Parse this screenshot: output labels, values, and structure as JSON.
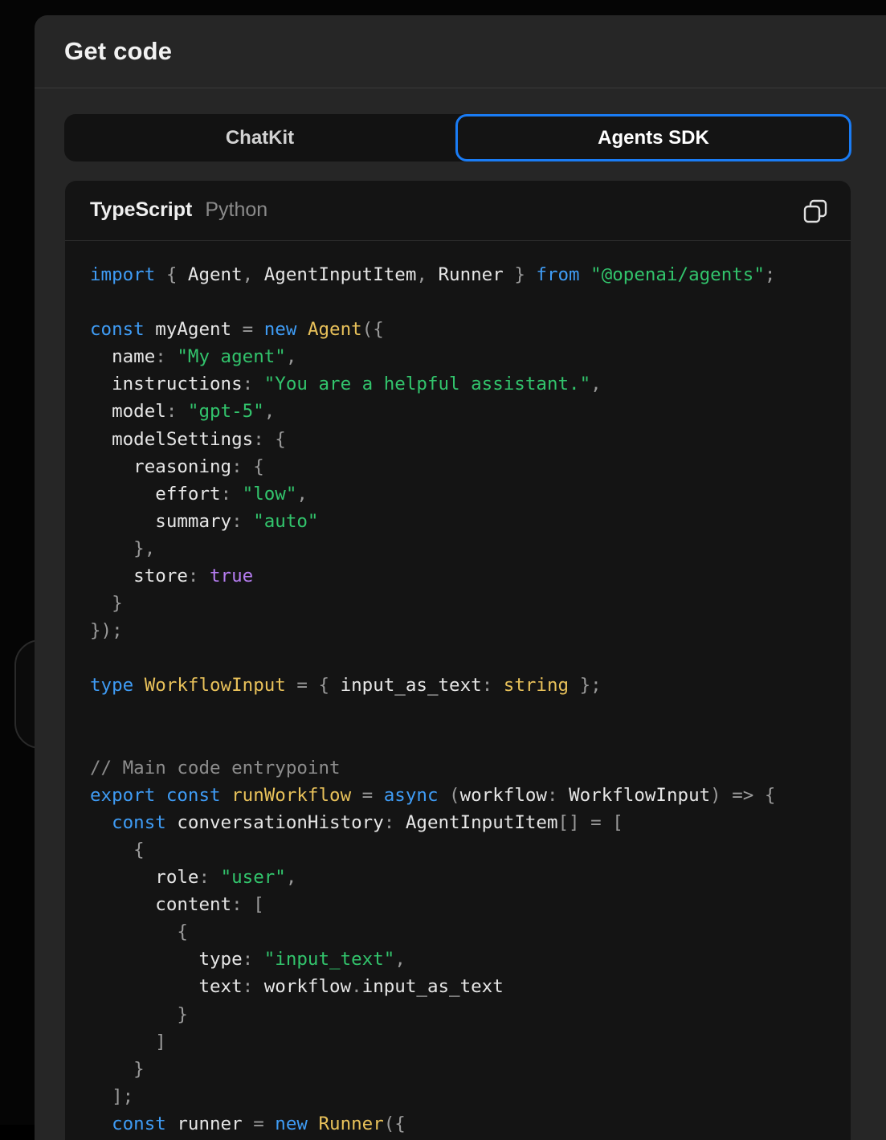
{
  "dialog": {
    "title": "Get code"
  },
  "segmented": {
    "options": [
      "ChatKit",
      "Agents SDK"
    ],
    "selected": "Agents SDK"
  },
  "code_panel": {
    "languages": [
      "TypeScript",
      "Python"
    ],
    "selected_language": "TypeScript",
    "copy_icon": "copy-icon",
    "lines": [
      [
        [
          "kw",
          "import"
        ],
        [
          "pn",
          " { "
        ],
        [
          "",
          "Agent"
        ],
        [
          "pn",
          ", "
        ],
        [
          "",
          "AgentInputItem"
        ],
        [
          "pn",
          ", "
        ],
        [
          "",
          "Runner"
        ],
        [
          "pn",
          " } "
        ],
        [
          "kw",
          "from"
        ],
        [
          "",
          " "
        ],
        [
          "str",
          "\"@openai/agents\""
        ],
        [
          "pn",
          ";"
        ]
      ],
      [],
      [
        [
          "kw",
          "const"
        ],
        [
          "",
          " myAgent "
        ],
        [
          "pn",
          "="
        ],
        [
          "",
          " "
        ],
        [
          "kw",
          "new"
        ],
        [
          "",
          " "
        ],
        [
          "fn",
          "Agent"
        ],
        [
          "pn",
          "({"
        ]
      ],
      [
        [
          "",
          "  name"
        ],
        [
          "pn",
          ": "
        ],
        [
          "str",
          "\"My agent\""
        ],
        [
          "pn",
          ","
        ]
      ],
      [
        [
          "",
          "  instructions"
        ],
        [
          "pn",
          ": "
        ],
        [
          "str",
          "\"You are a helpful assistant.\""
        ],
        [
          "pn",
          ","
        ]
      ],
      [
        [
          "",
          "  model"
        ],
        [
          "pn",
          ": "
        ],
        [
          "str",
          "\"gpt-5\""
        ],
        [
          "pn",
          ","
        ]
      ],
      [
        [
          "",
          "  modelSettings"
        ],
        [
          "pn",
          ": {"
        ]
      ],
      [
        [
          "",
          "    reasoning"
        ],
        [
          "pn",
          ": {"
        ]
      ],
      [
        [
          "",
          "      effort"
        ],
        [
          "pn",
          ": "
        ],
        [
          "str",
          "\"low\""
        ],
        [
          "pn",
          ","
        ]
      ],
      [
        [
          "",
          "      summary"
        ],
        [
          "pn",
          ": "
        ],
        [
          "str",
          "\"auto\""
        ]
      ],
      [
        [
          "pn",
          "    },"
        ]
      ],
      [
        [
          "",
          "    store"
        ],
        [
          "pn",
          ": "
        ],
        [
          "bool",
          "true"
        ]
      ],
      [
        [
          "pn",
          "  }"
        ]
      ],
      [
        [
          "pn",
          "});"
        ]
      ],
      [],
      [
        [
          "kw",
          "type"
        ],
        [
          "",
          " "
        ],
        [
          "fn",
          "WorkflowInput"
        ],
        [
          "",
          " "
        ],
        [
          "pn",
          "= { "
        ],
        [
          "",
          "input_as_text"
        ],
        [
          "pn",
          ": "
        ],
        [
          "fn",
          "string"
        ],
        [
          "pn",
          " };"
        ]
      ],
      [],
      [],
      [
        [
          "cm",
          "// Main code entrypoint"
        ]
      ],
      [
        [
          "kw",
          "export"
        ],
        [
          "",
          " "
        ],
        [
          "kw",
          "const"
        ],
        [
          "",
          " "
        ],
        [
          "fn",
          "runWorkflow"
        ],
        [
          "",
          " "
        ],
        [
          "pn",
          "="
        ],
        [
          "",
          " "
        ],
        [
          "kw",
          "async"
        ],
        [
          "pn",
          " ("
        ],
        [
          "",
          "workflow"
        ],
        [
          "pn",
          ": "
        ],
        [
          "",
          "WorkflowInput"
        ],
        [
          "pn",
          ") => {"
        ]
      ],
      [
        [
          "",
          "  "
        ],
        [
          "kw",
          "const"
        ],
        [
          "",
          " conversationHistory"
        ],
        [
          "pn",
          ": "
        ],
        [
          "",
          "AgentInputItem"
        ],
        [
          "pn",
          "[] = ["
        ]
      ],
      [
        [
          "pn",
          "    {"
        ]
      ],
      [
        [
          "",
          "      role"
        ],
        [
          "pn",
          ": "
        ],
        [
          "str",
          "\"user\""
        ],
        [
          "pn",
          ","
        ]
      ],
      [
        [
          "",
          "      content"
        ],
        [
          "pn",
          ": ["
        ]
      ],
      [
        [
          "pn",
          "        {"
        ]
      ],
      [
        [
          "",
          "          type"
        ],
        [
          "pn",
          ": "
        ],
        [
          "str",
          "\"input_text\""
        ],
        [
          "pn",
          ","
        ]
      ],
      [
        [
          "",
          "          text"
        ],
        [
          "pn",
          ": "
        ],
        [
          "",
          "workflow"
        ],
        [
          "pn",
          "."
        ],
        [
          "",
          "input_as_text"
        ]
      ],
      [
        [
          "pn",
          "        }"
        ]
      ],
      [
        [
          "pn",
          "      ]"
        ]
      ],
      [
        [
          "pn",
          "    }"
        ]
      ],
      [
        [
          "pn",
          "  ];"
        ]
      ],
      [
        [
          "",
          "  "
        ],
        [
          "kw",
          "const"
        ],
        [
          "",
          " runner "
        ],
        [
          "pn",
          "="
        ],
        [
          "",
          " "
        ],
        [
          "kw",
          "new"
        ],
        [
          "",
          " "
        ],
        [
          "fn",
          "Runner"
        ],
        [
          "pn",
          "({"
        ]
      ]
    ]
  },
  "colors": {
    "accent": "#1a7cf5",
    "keyword": "#3f9cf5",
    "string": "#32c46c",
    "type": "#e8c15a",
    "boolean": "#b57cf0",
    "comment": "#8c8c8c"
  }
}
